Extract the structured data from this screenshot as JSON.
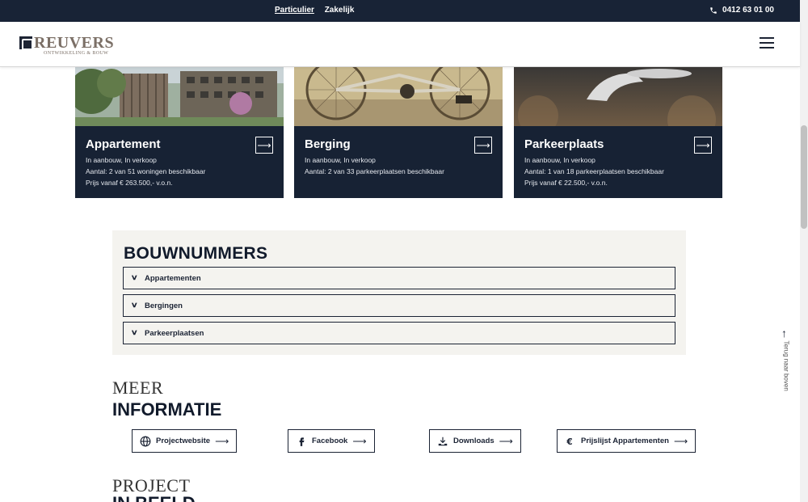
{
  "topbar": {
    "nav": [
      "Particulier",
      "Zakelijk"
    ],
    "phone": "0412 63 01 00"
  },
  "header": {
    "logo_text": "REUVERS",
    "logo_sub": "ONTWIKKELING & BOUW"
  },
  "cards": [
    {
      "title": "Appartement",
      "status": "In aanbouw, In verkoop",
      "count": "Aantal: 2 van 51 woningen beschikbaar",
      "price": "Prijs vanaf € 263.500,- v.o.n."
    },
    {
      "title": "Berging",
      "status": "In aanbouw, In verkoop",
      "count": "Aantal: 2 van 33 parkeerplaatsen beschikbaar",
      "price": ""
    },
    {
      "title": "Parkeerplaats",
      "status": "In aanbouw, In verkoop",
      "count": "Aantal: 1 van 18 parkeerplaatsen beschikbaar",
      "price": "Prijs vanaf € 22.500,- v.o.n."
    }
  ],
  "bouwnummers": {
    "title": "BOUWNUMMERS",
    "items": [
      "Appartementen",
      "Bergingen",
      "Parkeerplaatsen"
    ]
  },
  "meer": {
    "light": "MEER",
    "bold": "INFORMATIE",
    "buttons": [
      "Projectwebsite",
      "Facebook",
      "Downloads",
      "Prijslijst Appartementen"
    ]
  },
  "project": {
    "light": "PROJECT",
    "bold": "IN BEELD"
  },
  "totop": "Terug naar boven",
  "icons": {
    "card_arrow": "arrow-right-icon",
    "accordion": "chevron-down-icon",
    "buttons": [
      "globe-icon",
      "facebook-icon",
      "download-icon",
      "euro-icon"
    ]
  },
  "colors": {
    "navy": "#172234",
    "beige": "#f4f3ef",
    "logo_taupe": "#7b6f66"
  }
}
